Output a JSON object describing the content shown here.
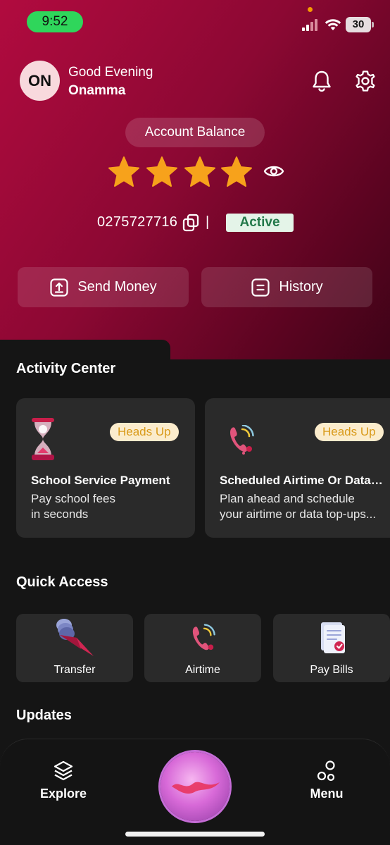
{
  "status_bar": {
    "time": "9:52",
    "battery": "30"
  },
  "header": {
    "avatar_initials": "ON",
    "greeting": "Good Evening",
    "user_name": "Onamma"
  },
  "balance": {
    "label": "Account Balance",
    "hidden_indicator_stars": 4,
    "account_number": "0275727716",
    "separator": "|",
    "status": "Active"
  },
  "actions": {
    "send_money": "Send Money",
    "history": "History"
  },
  "activity_center": {
    "title": "Activity Center",
    "cards": [
      {
        "badge": "Heads Up",
        "title": "School Service Payment",
        "desc_line1": "Pay school fees",
        "desc_line2": "in seconds"
      },
      {
        "badge": "Heads Up",
        "title": "Scheduled Airtime Or Data Top-Ups",
        "desc_line1": "Plan ahead and schedule",
        "desc_line2": "your airtime or data top-ups..."
      }
    ]
  },
  "quick_access": {
    "title": "Quick Access",
    "items": [
      "Transfer",
      "Airtime",
      "Pay Bills"
    ]
  },
  "updates": {
    "title": "Updates"
  },
  "bottom_nav": {
    "explore": "Explore",
    "menu": "Menu"
  },
  "colors": {
    "brand": "#a80a3c",
    "active_green": "#23794a",
    "badge_text": "#d99a1a",
    "star": "#f7a21b"
  }
}
